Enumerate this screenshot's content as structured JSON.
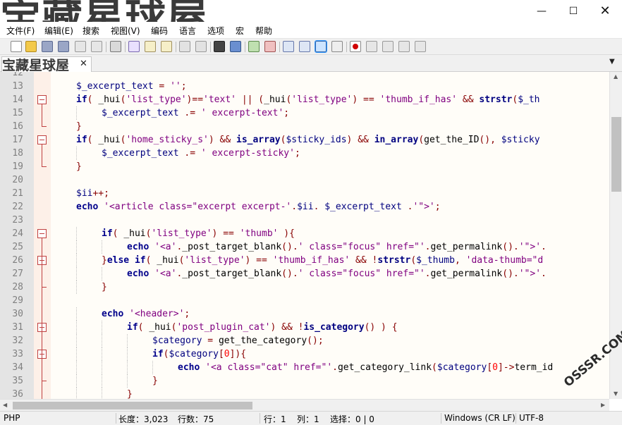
{
  "watermark": {
    "title": "宝藏星球屋",
    "tab": "宝藏星球屋",
    "corner": "OSSSR.COM"
  },
  "window": {
    "minimize": "—",
    "maximize": "☐",
    "close": "✕"
  },
  "menu": [
    "文件(F)",
    "编辑(E)",
    "搜索",
    "视图(V)",
    "编码",
    "语言",
    "选项",
    "宏",
    "帮助"
  ],
  "toolbar": {
    "icons": [
      "new-file-icon",
      "open-file-icon",
      "save-icon",
      "save-all-icon",
      "close-icon",
      "close-all-icon",
      "print-icon",
      "cut-icon",
      "copy-icon",
      "paste-icon",
      "undo-icon",
      "redo-icon",
      "find-icon",
      "replace-icon",
      "zoom-in-icon",
      "zoom-out-icon",
      "sync-scroll-icon",
      "word-wrap-icon",
      "show-all-chars-icon",
      "indent-guide-icon",
      "record-macro-icon",
      "stop-record-icon",
      "play-macro-icon",
      "run-macro-icon",
      "save-macro-icon"
    ]
  },
  "tab": {
    "close": "✕",
    "dropdown": "▼"
  },
  "editor": {
    "lines": [
      {
        "n": "12",
        "fold": "",
        "segs": []
      },
      {
        "n": "13",
        "fold": "",
        "indent": 1,
        "segs": [
          [
            "var",
            "$_excerpt_text"
          ],
          [
            "op",
            " = "
          ],
          [
            "str",
            "''"
          ],
          [
            "op",
            ";"
          ]
        ]
      },
      {
        "n": "14",
        "fold": "open",
        "indent": 1,
        "segs": [
          [
            "kw",
            "if"
          ],
          [
            "op",
            "( "
          ],
          [
            "plain",
            "_hui"
          ],
          [
            "op",
            "("
          ],
          [
            "str",
            "'list_type'"
          ],
          [
            "op",
            ")=="
          ],
          [
            "str",
            "'text'"
          ],
          [
            "op",
            " || ("
          ],
          [
            "plain",
            "_hui"
          ],
          [
            "op",
            "("
          ],
          [
            "str",
            "'list_type'"
          ],
          [
            "op",
            ") == "
          ],
          [
            "str",
            "'thumb_if_has'"
          ],
          [
            "op",
            " && "
          ],
          [
            "fn",
            "strstr"
          ],
          [
            "op",
            "("
          ],
          [
            "var",
            "$_th"
          ]
        ]
      },
      {
        "n": "15",
        "fold": "",
        "indent": 2,
        "segs": [
          [
            "var",
            "$_excerpt_text"
          ],
          [
            "op",
            " .= "
          ],
          [
            "str",
            "' excerpt-text'"
          ],
          [
            "op",
            ";"
          ]
        ]
      },
      {
        "n": "16",
        "fold": "end",
        "indent": 1,
        "segs": [
          [
            "op",
            "}"
          ]
        ]
      },
      {
        "n": "17",
        "fold": "open",
        "indent": 1,
        "segs": [
          [
            "kw",
            "if"
          ],
          [
            "op",
            "( "
          ],
          [
            "plain",
            "_hui"
          ],
          [
            "op",
            "("
          ],
          [
            "str",
            "'home_sticky_s'"
          ],
          [
            "op",
            ") && "
          ],
          [
            "fn",
            "is_array"
          ],
          [
            "op",
            "("
          ],
          [
            "var",
            "$sticky_ids"
          ],
          [
            "op",
            ") && "
          ],
          [
            "fn",
            "in_array"
          ],
          [
            "op",
            "("
          ],
          [
            "plain",
            "get_the_ID"
          ],
          [
            "op",
            "(), "
          ],
          [
            "var",
            "$sticky"
          ]
        ]
      },
      {
        "n": "18",
        "fold": "",
        "indent": 2,
        "segs": [
          [
            "var",
            "$_excerpt_text"
          ],
          [
            "op",
            " .= "
          ],
          [
            "str",
            "' excerpt-sticky'"
          ],
          [
            "op",
            ";"
          ]
        ]
      },
      {
        "n": "19",
        "fold": "end",
        "indent": 1,
        "segs": [
          [
            "op",
            "}"
          ]
        ]
      },
      {
        "n": "20",
        "fold": "",
        "segs": []
      },
      {
        "n": "21",
        "fold": "",
        "indent": 1,
        "segs": [
          [
            "var",
            "$ii"
          ],
          [
            "op",
            "++;"
          ]
        ]
      },
      {
        "n": "22",
        "fold": "",
        "indent": 1,
        "segs": [
          [
            "kw",
            "echo"
          ],
          [
            "plain",
            " "
          ],
          [
            "str",
            "'<article class=\"excerpt excerpt-'"
          ],
          [
            "op",
            "."
          ],
          [
            "var",
            "$ii"
          ],
          [
            "op",
            "."
          ],
          [
            "plain",
            " "
          ],
          [
            "var",
            "$_excerpt_text"
          ],
          [
            "plain",
            " "
          ],
          [
            "op",
            "."
          ],
          [
            "str",
            "'\">'"
          ],
          [
            "op",
            ";"
          ]
        ]
      },
      {
        "n": "23",
        "fold": "",
        "segs": []
      },
      {
        "n": "24",
        "fold": "open",
        "indent": 2,
        "segs": [
          [
            "kw",
            "if"
          ],
          [
            "op",
            "( "
          ],
          [
            "plain",
            "_hui"
          ],
          [
            "op",
            "("
          ],
          [
            "str",
            "'list_type'"
          ],
          [
            "op",
            ") == "
          ],
          [
            "str",
            "'thumb'"
          ],
          [
            "op",
            " ){"
          ]
        ]
      },
      {
        "n": "25",
        "fold": "",
        "indent": 3,
        "segs": [
          [
            "kw",
            "echo"
          ],
          [
            "plain",
            " "
          ],
          [
            "str",
            "'<a'"
          ],
          [
            "op",
            "."
          ],
          [
            "plain",
            "_post_target_blank"
          ],
          [
            "op",
            "()."
          ],
          [
            "str",
            "' class=\"focus\" href=\"'"
          ],
          [
            "op",
            "."
          ],
          [
            "plain",
            "get_permalink"
          ],
          [
            "op",
            "()."
          ],
          [
            "str",
            "'\">'"
          ],
          [
            "op",
            "."
          ]
        ]
      },
      {
        "n": "26",
        "fold": "open",
        "indent": 2,
        "segs": [
          [
            "op",
            "}"
          ],
          [
            "kw",
            "else if"
          ],
          [
            "op",
            "( "
          ],
          [
            "plain",
            "_hui"
          ],
          [
            "op",
            "("
          ],
          [
            "str",
            "'list_type'"
          ],
          [
            "op",
            ") == "
          ],
          [
            "str",
            "'thumb_if_has'"
          ],
          [
            "op",
            " && !"
          ],
          [
            "fn",
            "strstr"
          ],
          [
            "op",
            "("
          ],
          [
            "var",
            "$_thumb"
          ],
          [
            "op",
            ", "
          ],
          [
            "str",
            "'data-thumb=\"d"
          ]
        ]
      },
      {
        "n": "27",
        "fold": "",
        "indent": 3,
        "segs": [
          [
            "kw",
            "echo"
          ],
          [
            "plain",
            " "
          ],
          [
            "str",
            "'<a'"
          ],
          [
            "op",
            "."
          ],
          [
            "plain",
            "_post_target_blank"
          ],
          [
            "op",
            "()."
          ],
          [
            "str",
            "' class=\"focus\" href=\"'"
          ],
          [
            "op",
            "."
          ],
          [
            "plain",
            "get_permalink"
          ],
          [
            "op",
            "()."
          ],
          [
            "str",
            "'\">'"
          ],
          [
            "op",
            "."
          ]
        ]
      },
      {
        "n": "28",
        "fold": "end",
        "indent": 2,
        "segs": [
          [
            "op",
            "}"
          ]
        ]
      },
      {
        "n": "29",
        "fold": "",
        "segs": []
      },
      {
        "n": "30",
        "fold": "",
        "indent": 2,
        "segs": [
          [
            "kw",
            "echo"
          ],
          [
            "plain",
            " "
          ],
          [
            "str",
            "'<header>'"
          ],
          [
            "op",
            ";"
          ]
        ]
      },
      {
        "n": "31",
        "fold": "open",
        "indent": 3,
        "segs": [
          [
            "kw",
            "if"
          ],
          [
            "op",
            "( "
          ],
          [
            "plain",
            "_hui"
          ],
          [
            "op",
            "("
          ],
          [
            "str",
            "'post_plugin_cat'"
          ],
          [
            "op",
            ") && !"
          ],
          [
            "fn",
            "is_category"
          ],
          [
            "op",
            "() ) {"
          ]
        ]
      },
      {
        "n": "32",
        "fold": "",
        "indent": 4,
        "segs": [
          [
            "var",
            "$category"
          ],
          [
            "op",
            " = "
          ],
          [
            "plain",
            "get_the_category"
          ],
          [
            "op",
            "();"
          ]
        ]
      },
      {
        "n": "33",
        "fold": "open",
        "indent": 4,
        "segs": [
          [
            "kw",
            "if"
          ],
          [
            "op",
            "("
          ],
          [
            "var",
            "$category"
          ],
          [
            "op",
            "["
          ],
          [
            "num",
            "0"
          ],
          [
            "op",
            "]){"
          ]
        ]
      },
      {
        "n": "34",
        "fold": "",
        "indent": 5,
        "segs": [
          [
            "kw",
            "echo"
          ],
          [
            "plain",
            " "
          ],
          [
            "str",
            "'<a class=\"cat\" href=\"'"
          ],
          [
            "op",
            "."
          ],
          [
            "plain",
            "get_category_link"
          ],
          [
            "op",
            "("
          ],
          [
            "var",
            "$category"
          ],
          [
            "op",
            "["
          ],
          [
            "num",
            "0"
          ],
          [
            "op",
            "]->"
          ],
          [
            "plain",
            "term_id"
          ]
        ]
      },
      {
        "n": "35",
        "fold": "end",
        "indent": 4,
        "segs": [
          [
            "op",
            "}"
          ]
        ]
      },
      {
        "n": "36",
        "fold": "",
        "indent": 3,
        "segs": [
          [
            "op",
            "}"
          ]
        ]
      }
    ]
  },
  "scroll": {
    "up": "▲",
    "down": "▼",
    "left": "◀",
    "right": "▶"
  },
  "status": {
    "lang": "PHP",
    "length": "长度：3,023",
    "lines": "行数：75",
    "row": "行：1",
    "col": "列：1",
    "sel": "选择：0 | 0",
    "eol": "Windows (CR LF)",
    "enc": "UTF-8"
  }
}
